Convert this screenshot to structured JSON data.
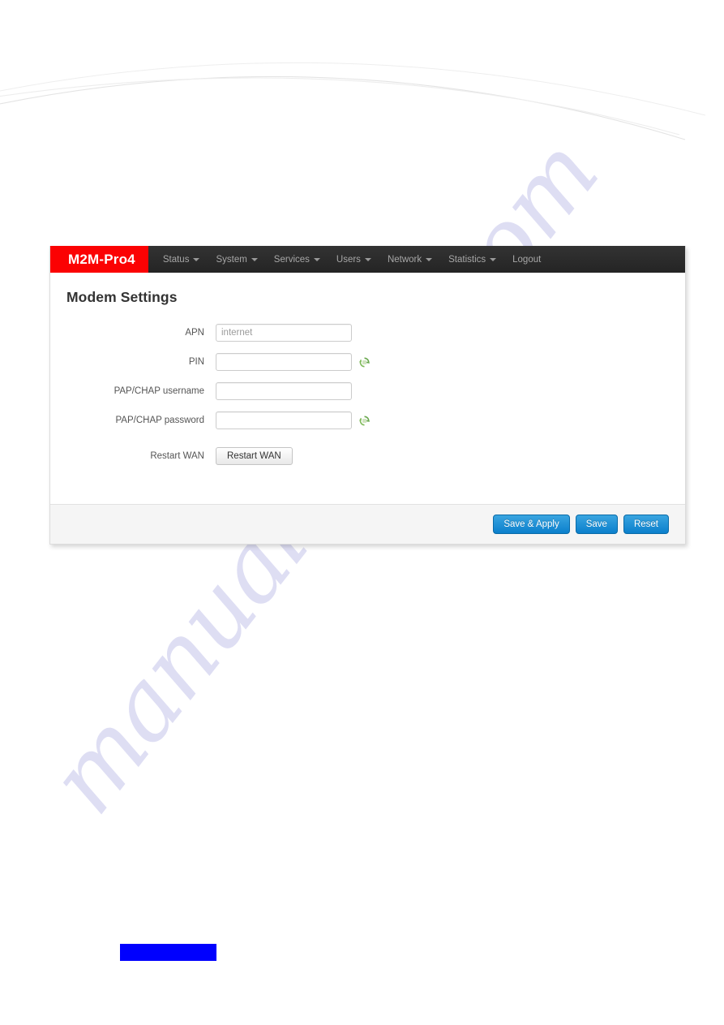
{
  "document": {
    "watermark_text": "manualshive.com",
    "watermark_color": "#d9d9f2",
    "arc_color": "#e6e6e6",
    "redaction_color": "#0000fe"
  },
  "navbar": {
    "brand": "M2M-Pro4",
    "brand_bg": "#fb0203",
    "bg": "#2b2b2b",
    "items": [
      {
        "label": "Status",
        "has_caret": true
      },
      {
        "label": "System",
        "has_caret": true
      },
      {
        "label": "Services",
        "has_caret": true
      },
      {
        "label": "Users",
        "has_caret": true
      },
      {
        "label": "Network",
        "has_caret": true
      },
      {
        "label": "Statistics",
        "has_caret": true
      },
      {
        "label": "Logout",
        "has_caret": false
      }
    ]
  },
  "main": {
    "title": "Modem Settings",
    "fields": [
      {
        "label": "APN",
        "value": "internet",
        "placeholder": "",
        "type": "text",
        "has_refresh_icon": false
      },
      {
        "label": "PIN",
        "value": "",
        "placeholder": "",
        "type": "text",
        "has_refresh_icon": true
      },
      {
        "label": "PAP/CHAP username",
        "value": "",
        "placeholder": "",
        "type": "text",
        "has_refresh_icon": false
      },
      {
        "label": "PAP/CHAP password",
        "value": "",
        "placeholder": "",
        "type": "text",
        "has_refresh_icon": true
      }
    ],
    "restart_row": {
      "label": "Restart WAN",
      "button_label": "Restart WAN"
    }
  },
  "footer": {
    "buttons": [
      {
        "label": "Save & Apply"
      },
      {
        "label": "Save"
      },
      {
        "label": "Reset"
      }
    ],
    "accent_color": "#0b7fcc"
  }
}
